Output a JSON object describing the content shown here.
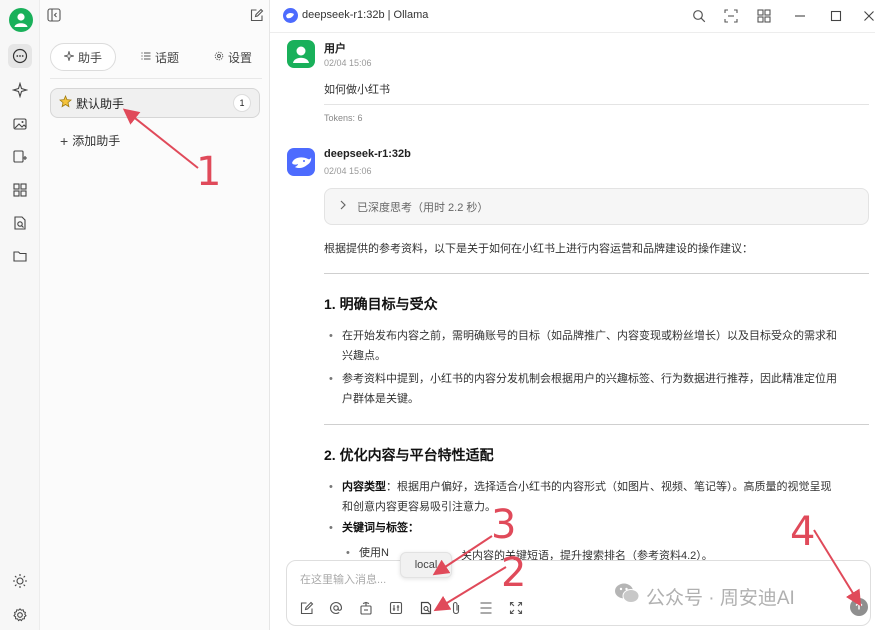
{
  "colors": {
    "accent": "#19b05a",
    "annotation": "#e04a5a",
    "model_logo": "#4d6bfe"
  },
  "window": {
    "title": "deepseek-r1:32b | Ollama"
  },
  "rail": {
    "icons": [
      "user-avatar",
      "chat-icon",
      "sparkle-icon",
      "image-icon",
      "translate-icon",
      "apps-icon",
      "document-search-icon",
      "folder-icon",
      "sun-icon",
      "settings-icon"
    ]
  },
  "panel": {
    "tabs": [
      {
        "label": "助手",
        "icon": "sparkle-icon"
      },
      {
        "label": "话题",
        "icon": "list-icon"
      },
      {
        "label": "设置",
        "icon": "gear-icon"
      }
    ],
    "assistant": {
      "label": "默认助手",
      "count": "1",
      "icon": "star-icon"
    },
    "add_assistant": "添加助手"
  },
  "messages": {
    "user": {
      "name": "用户",
      "time": "02/04 15:06",
      "text": "如何做小红书",
      "tokens": "Tokens: 6"
    },
    "assistant": {
      "name": "deepseek-r1:32b",
      "time": "02/04 15:06",
      "thinking": "已深度思考（用时 2.2 秒）",
      "intro": "根据提供的参考资料，以下是关于如何在小红书上进行内容运营和品牌建设的操作建议：",
      "section1": {
        "heading": "1. 明确目标与受众",
        "bullet1_line1": "在开始发布内容之前，需明确账号的目标（如品牌推广、内容变现或粉丝增长）以及目标受众的需求和",
        "bullet1_line2": "兴趣点。",
        "bullet2_line1": "参考资料中提到，小红书的内容分发机制会根据用户的兴趣标签、行为数据进行推荐，因此精准定位用",
        "bullet2_line2": "户群体是关键。"
      },
      "section2": {
        "heading": "2. 优化内容与平台特性适配",
        "b1_bold": "内容类型",
        "b1_line1": "：根据用户偏好，选择适合小红书的内容形式（如图片、视频、笔记等）。高质量的视觉呈现",
        "b1_line2": "和创意内容更容易吸引注意力。",
        "b2_bold": "关键词与标签",
        "b2_colon": "：",
        "sub_start": "使用N",
        "sub_end": "关内容的关键短语，提升搜索排名（参考资料4.2）。"
      }
    }
  },
  "input": {
    "placeholder": "在这里输入消息..."
  },
  "tooltip": {
    "label": "local"
  },
  "annotations": [
    "1",
    "2",
    "3",
    "4"
  ],
  "watermark": "公众号 · 周安迪AI"
}
